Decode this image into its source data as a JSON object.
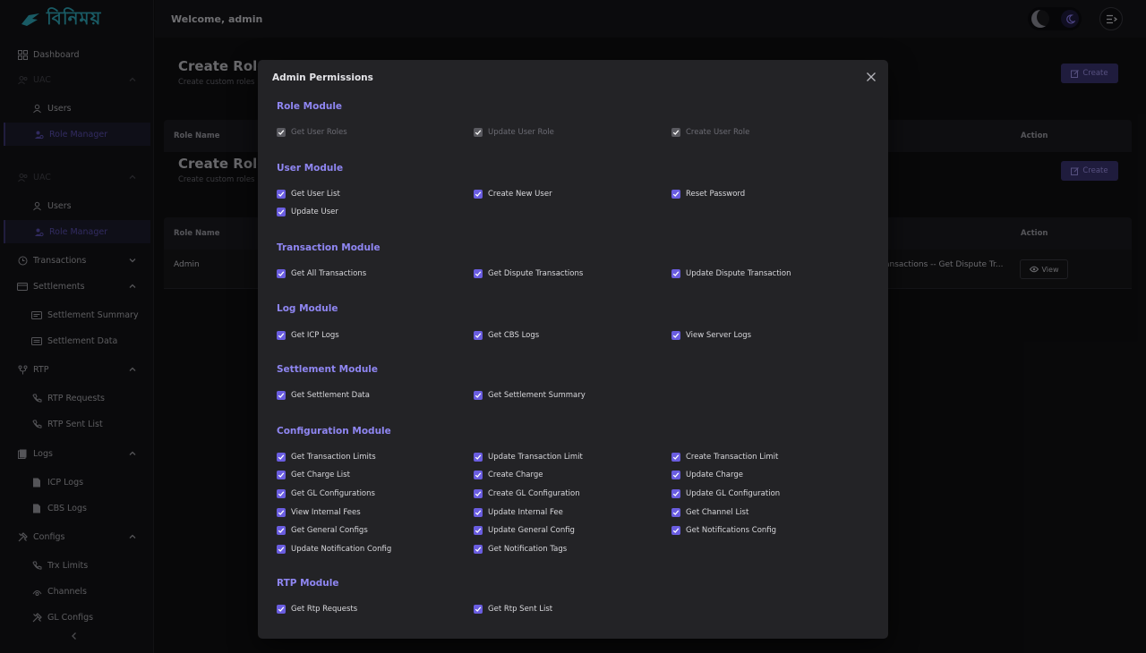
{
  "app": {
    "logo_text": "বিনিময়"
  },
  "header": {
    "welcome": "Welcome,  admin"
  },
  "sidebar": {
    "items": [
      {
        "label": "Dashboard",
        "icon": "dashboard-icon"
      },
      {
        "label": "UAC",
        "icon": "users-group-icon"
      },
      {
        "label": "Users",
        "icon": "user-icon"
      },
      {
        "label": "Role Manager",
        "icon": "role-icon"
      },
      {
        "label": "UAC",
        "icon": "users-group-icon"
      },
      {
        "label": "Users",
        "icon": "user-icon"
      },
      {
        "label": "Role Manager",
        "icon": "role-icon"
      },
      {
        "label": "Transactions",
        "icon": "clock-icon"
      },
      {
        "label": "Settlements",
        "icon": "settlements-icon"
      },
      {
        "label": "Settlement Summary",
        "icon": "summary-icon"
      },
      {
        "label": "Settlement Data",
        "icon": "data-icon"
      },
      {
        "label": "RTP",
        "icon": "rtp-icon"
      },
      {
        "label": "RTP Requests",
        "icon": "phone-icon"
      },
      {
        "label": "RTP Sent List",
        "icon": "phone-icon"
      },
      {
        "label": "Logs",
        "icon": "logs-icon"
      },
      {
        "label": "ICP Logs",
        "icon": "file-icon"
      },
      {
        "label": "CBS Logs",
        "icon": "file-icon"
      },
      {
        "label": "Configs",
        "icon": "tools-icon"
      },
      {
        "label": "Trx Limits",
        "icon": "limit-icon"
      },
      {
        "label": "Channels",
        "icon": "channels-icon"
      },
      {
        "label": "GL Configs",
        "icon": "tools-icon"
      }
    ]
  },
  "page": {
    "title": "Create Role",
    "subtitle": "Create custom roles",
    "create_label": "Create",
    "table": {
      "col_role_name": "Role Name",
      "col_action": "Action",
      "rows": [
        {
          "role_name": "Admin",
          "permissions_preview": "ansactions -- Get Dispute Tr...",
          "view_label": "View"
        }
      ]
    }
  },
  "modal": {
    "title": "Admin Permissions",
    "sections": [
      {
        "title": "Role Module",
        "permissions": [
          {
            "label": "Get User Roles",
            "checked": true,
            "disabled": true
          },
          {
            "label": "Update User Role",
            "checked": true,
            "disabled": true
          },
          {
            "label": "Create User Role",
            "checked": true,
            "disabled": true
          }
        ]
      },
      {
        "title": "User Module",
        "permissions": [
          {
            "label": "Get User List",
            "checked": true
          },
          {
            "label": "Create New User",
            "checked": true
          },
          {
            "label": "Reset Password",
            "checked": true
          },
          {
            "label": "Update User",
            "checked": true
          }
        ]
      },
      {
        "title": "Transaction Module",
        "permissions": [
          {
            "label": "Get All Transactions",
            "checked": true
          },
          {
            "label": "Get Dispute Transactions",
            "checked": true
          },
          {
            "label": "Update Dispute Transaction",
            "checked": true
          }
        ]
      },
      {
        "title": "Log Module",
        "permissions": [
          {
            "label": "Get ICP Logs",
            "checked": true
          },
          {
            "label": "Get CBS Logs",
            "checked": true
          },
          {
            "label": "View Server Logs",
            "checked": true
          }
        ]
      },
      {
        "title": "Settlement Module",
        "permissions": [
          {
            "label": "Get Settlement Data",
            "checked": true
          },
          {
            "label": "Get Settlement Summary",
            "checked": true
          }
        ]
      },
      {
        "title": "Configuration Module",
        "permissions": [
          {
            "label": "Get Transaction Limits",
            "checked": true
          },
          {
            "label": "Update Transaction Limit",
            "checked": true
          },
          {
            "label": "Create Transaction Limit",
            "checked": true
          },
          {
            "label": "Get Charge List",
            "checked": true
          },
          {
            "label": "Create Charge",
            "checked": true
          },
          {
            "label": "Update Charge",
            "checked": true
          },
          {
            "label": "Get GL Configurations",
            "checked": true
          },
          {
            "label": "Create GL Configuration",
            "checked": true
          },
          {
            "label": "Update GL Configuration",
            "checked": true
          },
          {
            "label": "View Internal Fees",
            "checked": true
          },
          {
            "label": "Update Internal Fee",
            "checked": true
          },
          {
            "label": "Get Channel List",
            "checked": true
          },
          {
            "label": "Get General Configs",
            "checked": true
          },
          {
            "label": "Update General Config",
            "checked": true
          },
          {
            "label": "Get Notifications Config",
            "checked": true
          },
          {
            "label": "Update Notification Config",
            "checked": true
          },
          {
            "label": "Get Notification Tags",
            "checked": true
          }
        ]
      },
      {
        "title": "RTP Module",
        "permissions": [
          {
            "label": "Get Rtp Requests",
            "checked": true
          },
          {
            "label": "Get Rtp Sent List",
            "checked": true
          }
        ]
      }
    ]
  },
  "colors": {
    "accent": "#6a5de0",
    "section_title": "#8f86f2",
    "modal_bg": "#232326",
    "page_bg": "#101012"
  }
}
